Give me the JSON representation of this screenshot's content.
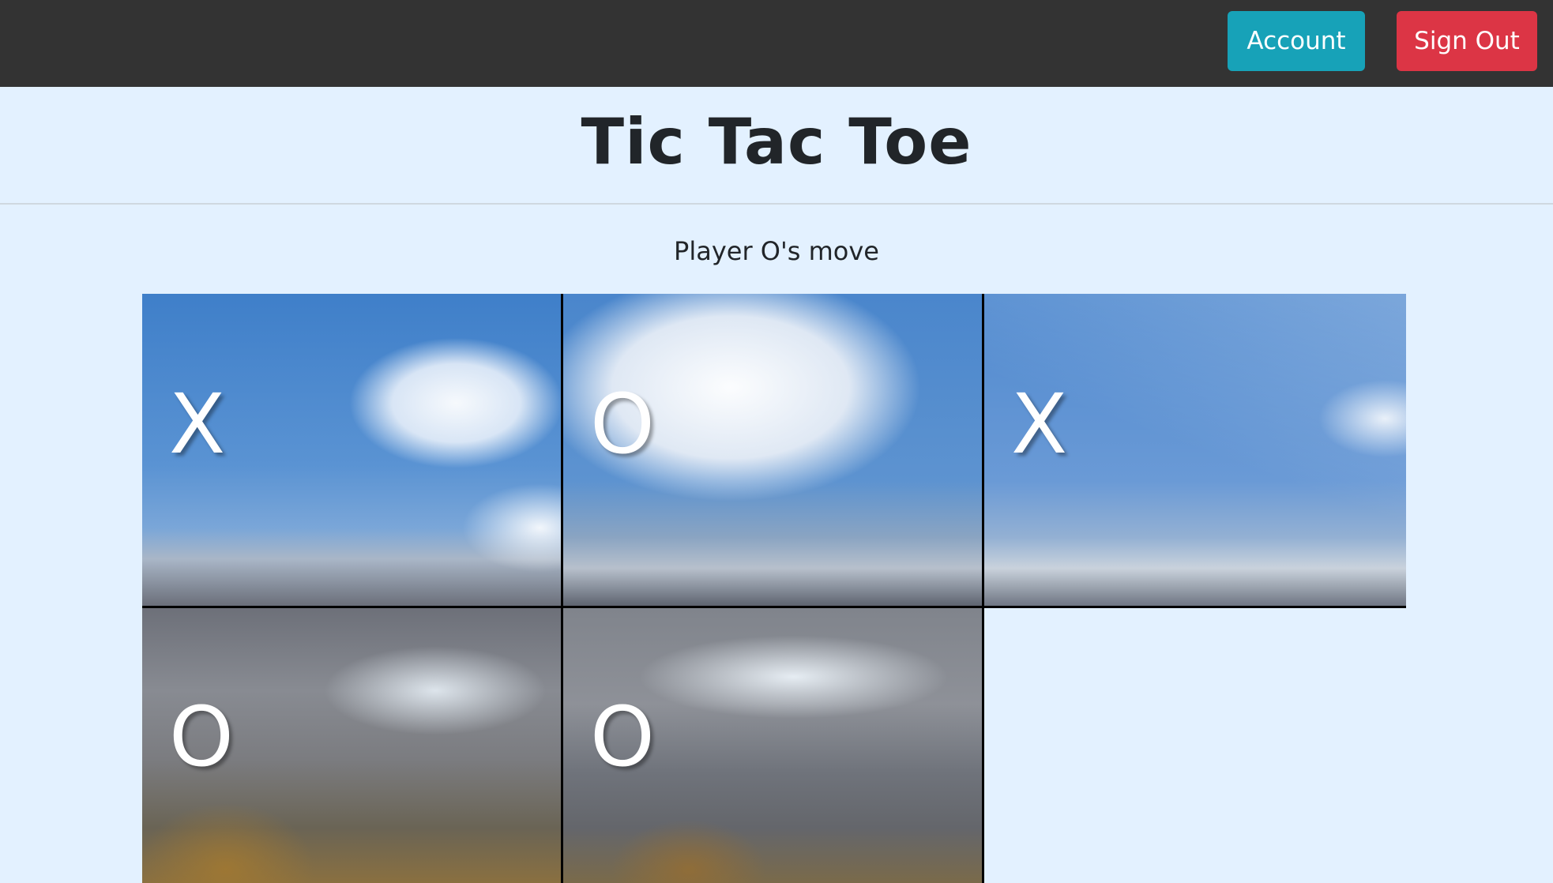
{
  "header": {
    "account_label": "Account",
    "signout_label": "Sign Out",
    "account_color": "#17a2b8",
    "signout_color": "#dc3545",
    "bar_color": "#333333"
  },
  "page": {
    "title": "Tic Tac Toe",
    "status": "Player O's move",
    "background_color": "#e3f1ff"
  },
  "board": {
    "background": "mountain-landscape-photo",
    "cells": [
      {
        "row": 1,
        "col": 1,
        "mark": "X"
      },
      {
        "row": 1,
        "col": 2,
        "mark": "O"
      },
      {
        "row": 1,
        "col": 3,
        "mark": "X"
      },
      {
        "row": 2,
        "col": 1,
        "mark": "O"
      },
      {
        "row": 2,
        "col": 2,
        "mark": "O"
      },
      {
        "row": 2,
        "col": 3,
        "mark": ""
      }
    ]
  }
}
